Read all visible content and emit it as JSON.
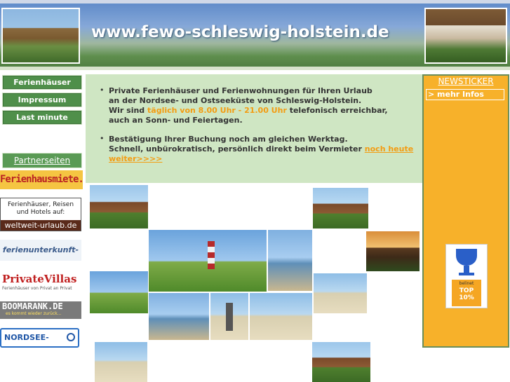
{
  "header": {
    "title": "www.fewo-schleswig-holstein.de"
  },
  "nav": {
    "items": [
      {
        "label": "Ferienhäuser"
      },
      {
        "label": "Impressum"
      },
      {
        "label": "Last minute"
      }
    ]
  },
  "partners": {
    "heading": "Partnerseiten",
    "items": [
      {
        "text": "Ferienhausmiete.de"
      },
      {
        "text": "Ferienhäuser, Reisen und Hotels auf:",
        "sub": "weltweit-urlaub.de"
      },
      {
        "text": "ferienunterkunft-direkt.de"
      },
      {
        "text": "PrivateVillas",
        "sub": "Ferienhäuser von Privat an Privat"
      },
      {
        "text": "BOOMARANK.DE",
        "sub": "es kommt wieder zurück..."
      },
      {
        "text": "NORDSEE-SUCHE.de"
      }
    ]
  },
  "info": {
    "bullet1": {
      "line1": "Private Ferienhäuser und Ferienwohnungen für Ihren Urlaub",
      "line2": "an der Nordsee- und Ostseeküste von Schleswig-Holstein.",
      "line3_pre": "Wir sind ",
      "line3_hl": "täglich von 8.00 Uhr - 21.00 Uhr",
      "line3_post": " telefonisch erreichbar,",
      "line4": "auch an Sonn- und Feiertagen."
    },
    "bullet2": {
      "line1": "Bestätigung Ihrer Buchung noch am gleichen Werktag.",
      "line2_pre": "Schnell, unbürokratisch, persönlich direkt beim Vermieter  ",
      "line2_link": "noch heute",
      "line3_link": "weiter>>>>"
    }
  },
  "ticker": {
    "title": "NEWSTICKER",
    "link": "> mehr Infos",
    "badge": {
      "top_text": "belinet",
      "rank": "TOP",
      "percent": "10%"
    }
  },
  "colors": {
    "nav_green": "#4f8f4a",
    "info_bg": "#cfe6c3",
    "highlight_orange": "#f39c12",
    "ticker_orange": "#f7b12a"
  }
}
